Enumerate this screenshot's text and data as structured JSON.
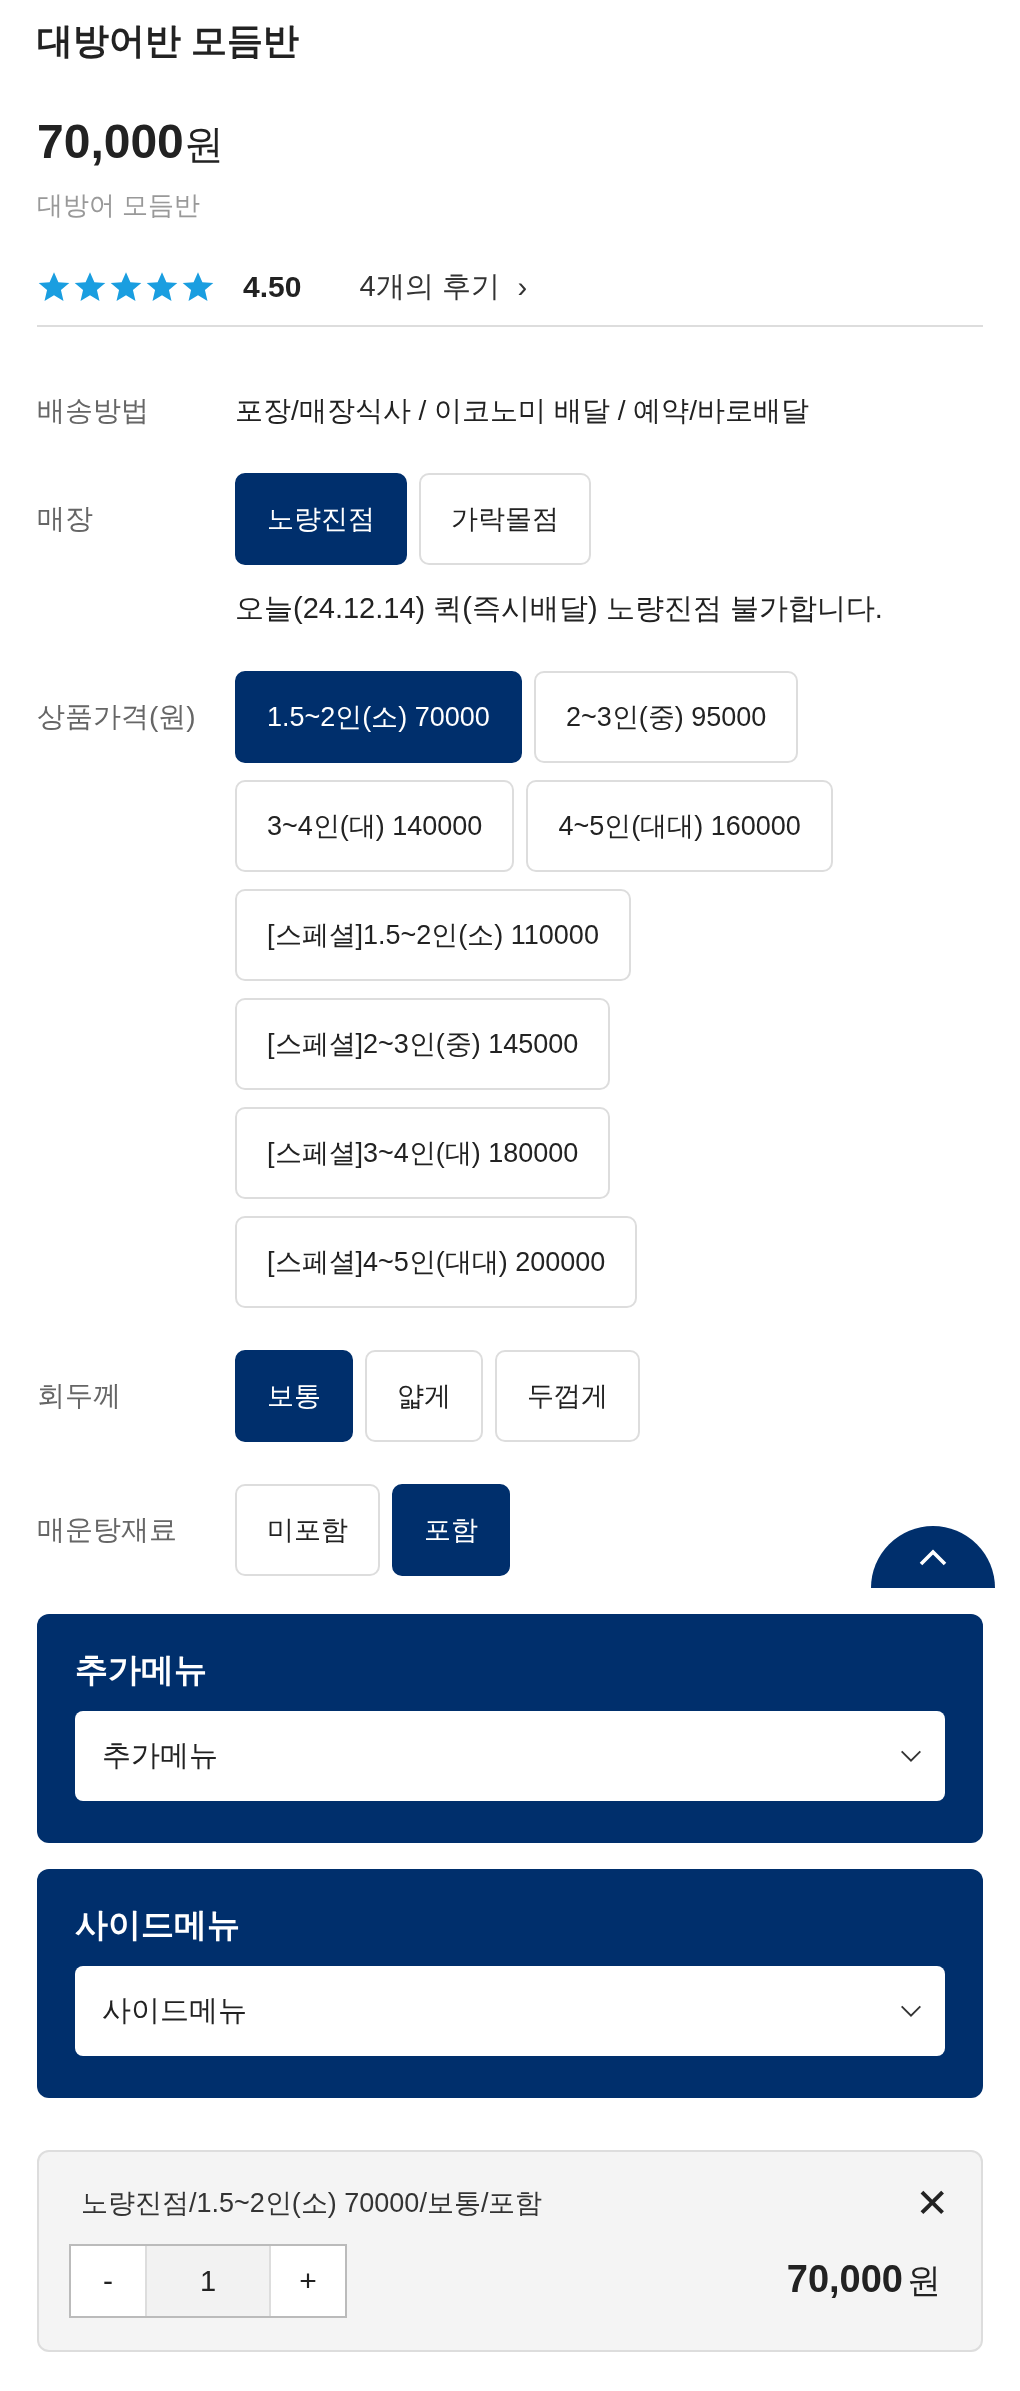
{
  "product": {
    "title": "대방어반 모듬반",
    "price": "70,000",
    "price_unit": "원",
    "subtitle": "대방어 모듬반"
  },
  "rating": {
    "stars": 5,
    "score": "4.50",
    "reviews_link": "4개의 후기",
    "link_arrow": "›"
  },
  "delivery": {
    "label": "배송방법",
    "value": "포장/매장식사 / 이코노미 배달 / 예약/바로배달"
  },
  "option_groups": [
    {
      "label": "매장",
      "options": [
        {
          "label": "노량진점",
          "selected": true
        },
        {
          "label": "가락몰점",
          "selected": false
        }
      ],
      "notice": "오늘(24.12.14) 퀵(즉시배달) 노량진점 불가합니다."
    },
    {
      "label": "상품가격(원)",
      "options": [
        {
          "label": "1.5~2인(소) 70000",
          "selected": true
        },
        {
          "label": "2~3인(중) 95000",
          "selected": false
        },
        {
          "label": "3~4인(대) 140000",
          "selected": false
        },
        {
          "label": "4~5인(대대) 160000",
          "selected": false
        },
        {
          "label": "[스페셜]1.5~2인(소) 110000",
          "selected": false
        },
        {
          "label": "[스페셜]2~3인(중) 145000",
          "selected": false
        },
        {
          "label": "[스페셜]3~4인(대) 180000",
          "selected": false
        },
        {
          "label": "[스페셜]4~5인(대대) 200000",
          "selected": false
        }
      ]
    },
    {
      "label": "회두께",
      "options": [
        {
          "label": "보통",
          "selected": true
        },
        {
          "label": "얇게",
          "selected": false
        },
        {
          "label": "두껍게",
          "selected": false
        }
      ]
    },
    {
      "label": "매운탕재료",
      "options": [
        {
          "label": "미포함",
          "selected": false
        },
        {
          "label": "포함",
          "selected": true
        }
      ]
    }
  ],
  "menus": [
    {
      "title": "추가메뉴",
      "placeholder": "추가메뉴"
    },
    {
      "title": "사이드메뉴",
      "placeholder": "사이드메뉴"
    }
  ],
  "cart_item": {
    "description": "노량진점/1.5~2인(소) 70000/보통/포함",
    "decrement": "-",
    "quantity": "1",
    "increment": "+",
    "remove": "✕",
    "price": "70,000",
    "price_unit": "원"
  }
}
